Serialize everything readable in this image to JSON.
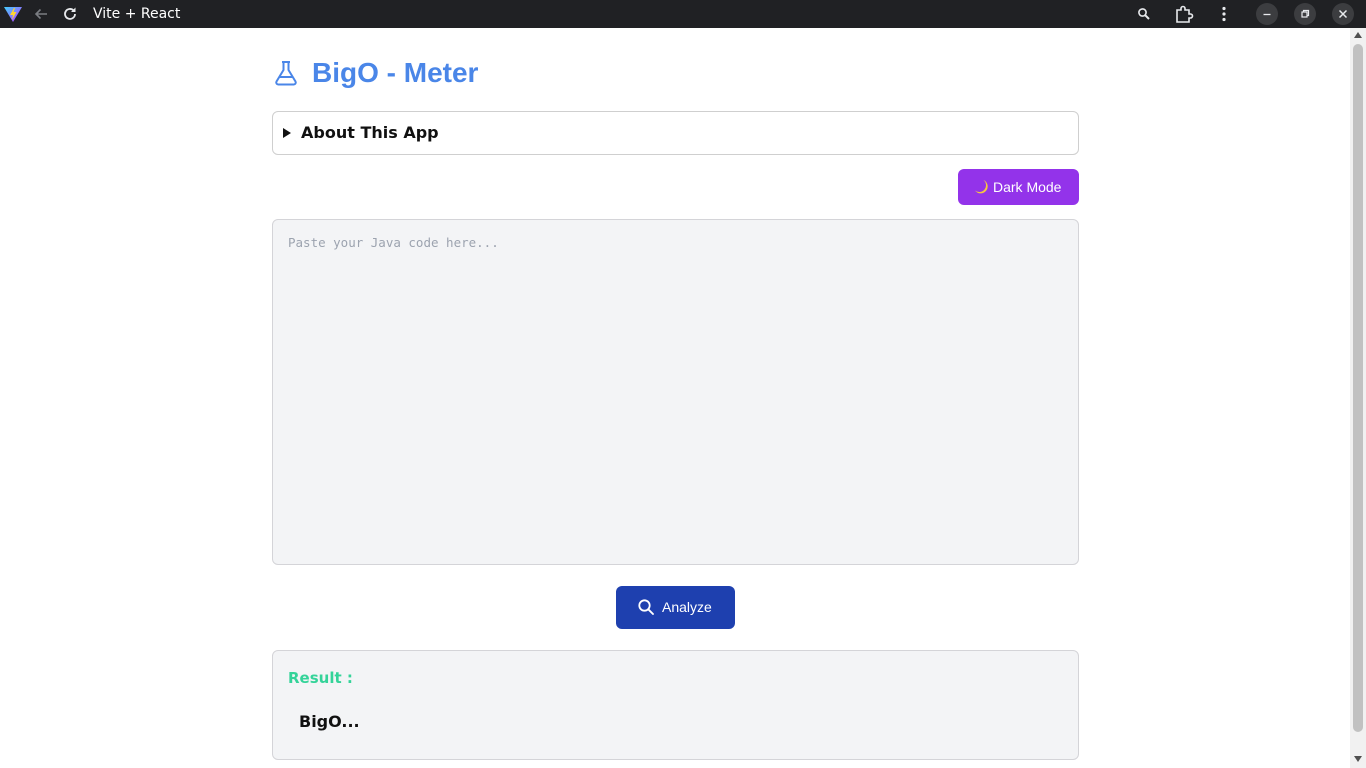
{
  "browser": {
    "tab_title": "Vite + React",
    "logo_icon": "vite-logo-icon",
    "back_icon": "arrow-left-icon",
    "reload_icon": "reload-icon",
    "zoom_icon": "zoom-icon",
    "extensions_icon": "puzzle-icon",
    "menu_icon": "kebab-menu-icon",
    "minimize_icon": "minimize-icon",
    "maximize_icon": "restore-icon",
    "close_icon": "close-icon"
  },
  "app": {
    "title": "BigO - Meter",
    "title_icon": "flask-icon",
    "accent_color": "#4a86e8",
    "about": {
      "label": "About This App",
      "expanded": false
    },
    "theme_toggle": {
      "label": "Dark Mode",
      "icon": "moon-icon",
      "color": "#9333ea"
    },
    "editor": {
      "placeholder": "Paste your Java code here...",
      "value": ""
    },
    "analyze_button": {
      "label": "Analyze",
      "icon": "search-icon",
      "color": "#1e40af"
    },
    "result": {
      "label": "Result :",
      "value": "BigO...",
      "label_color": "#34d399"
    }
  }
}
